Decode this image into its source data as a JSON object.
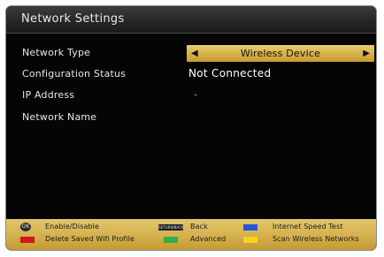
{
  "window": {
    "title": "Network Settings"
  },
  "settings": {
    "network_type": {
      "label": "Network Type",
      "value": "Wireless Device"
    },
    "configuration_status": {
      "label": "Configuration Status",
      "value": "Not Connected"
    },
    "ip_address": {
      "label": "IP Address",
      "value": "-"
    },
    "network_name": {
      "label": "Network Name",
      "value": ""
    }
  },
  "footer": {
    "items": [
      {
        "key": "OK",
        "label": "Enable/Disable",
        "color": "#2a2a2a"
      },
      {
        "key": "RETURN/BACK",
        "label": "Back",
        "color": "#1e1e1e"
      },
      {
        "key": "blue",
        "label": "Internet Speed Test",
        "color": "#2456d6"
      },
      {
        "key": "red",
        "label": "Delete Saved Wifi Profile",
        "color": "#d01818"
      },
      {
        "key": "green",
        "label": "Advanced",
        "color": "#2fb04a"
      },
      {
        "key": "yellow",
        "label": "Scan Wireless Networks",
        "color": "#f5d51a"
      }
    ]
  },
  "colors": {
    "accent_gold": "#d8b24d",
    "panel_background": "#050505",
    "text": "#e6e6e6"
  }
}
